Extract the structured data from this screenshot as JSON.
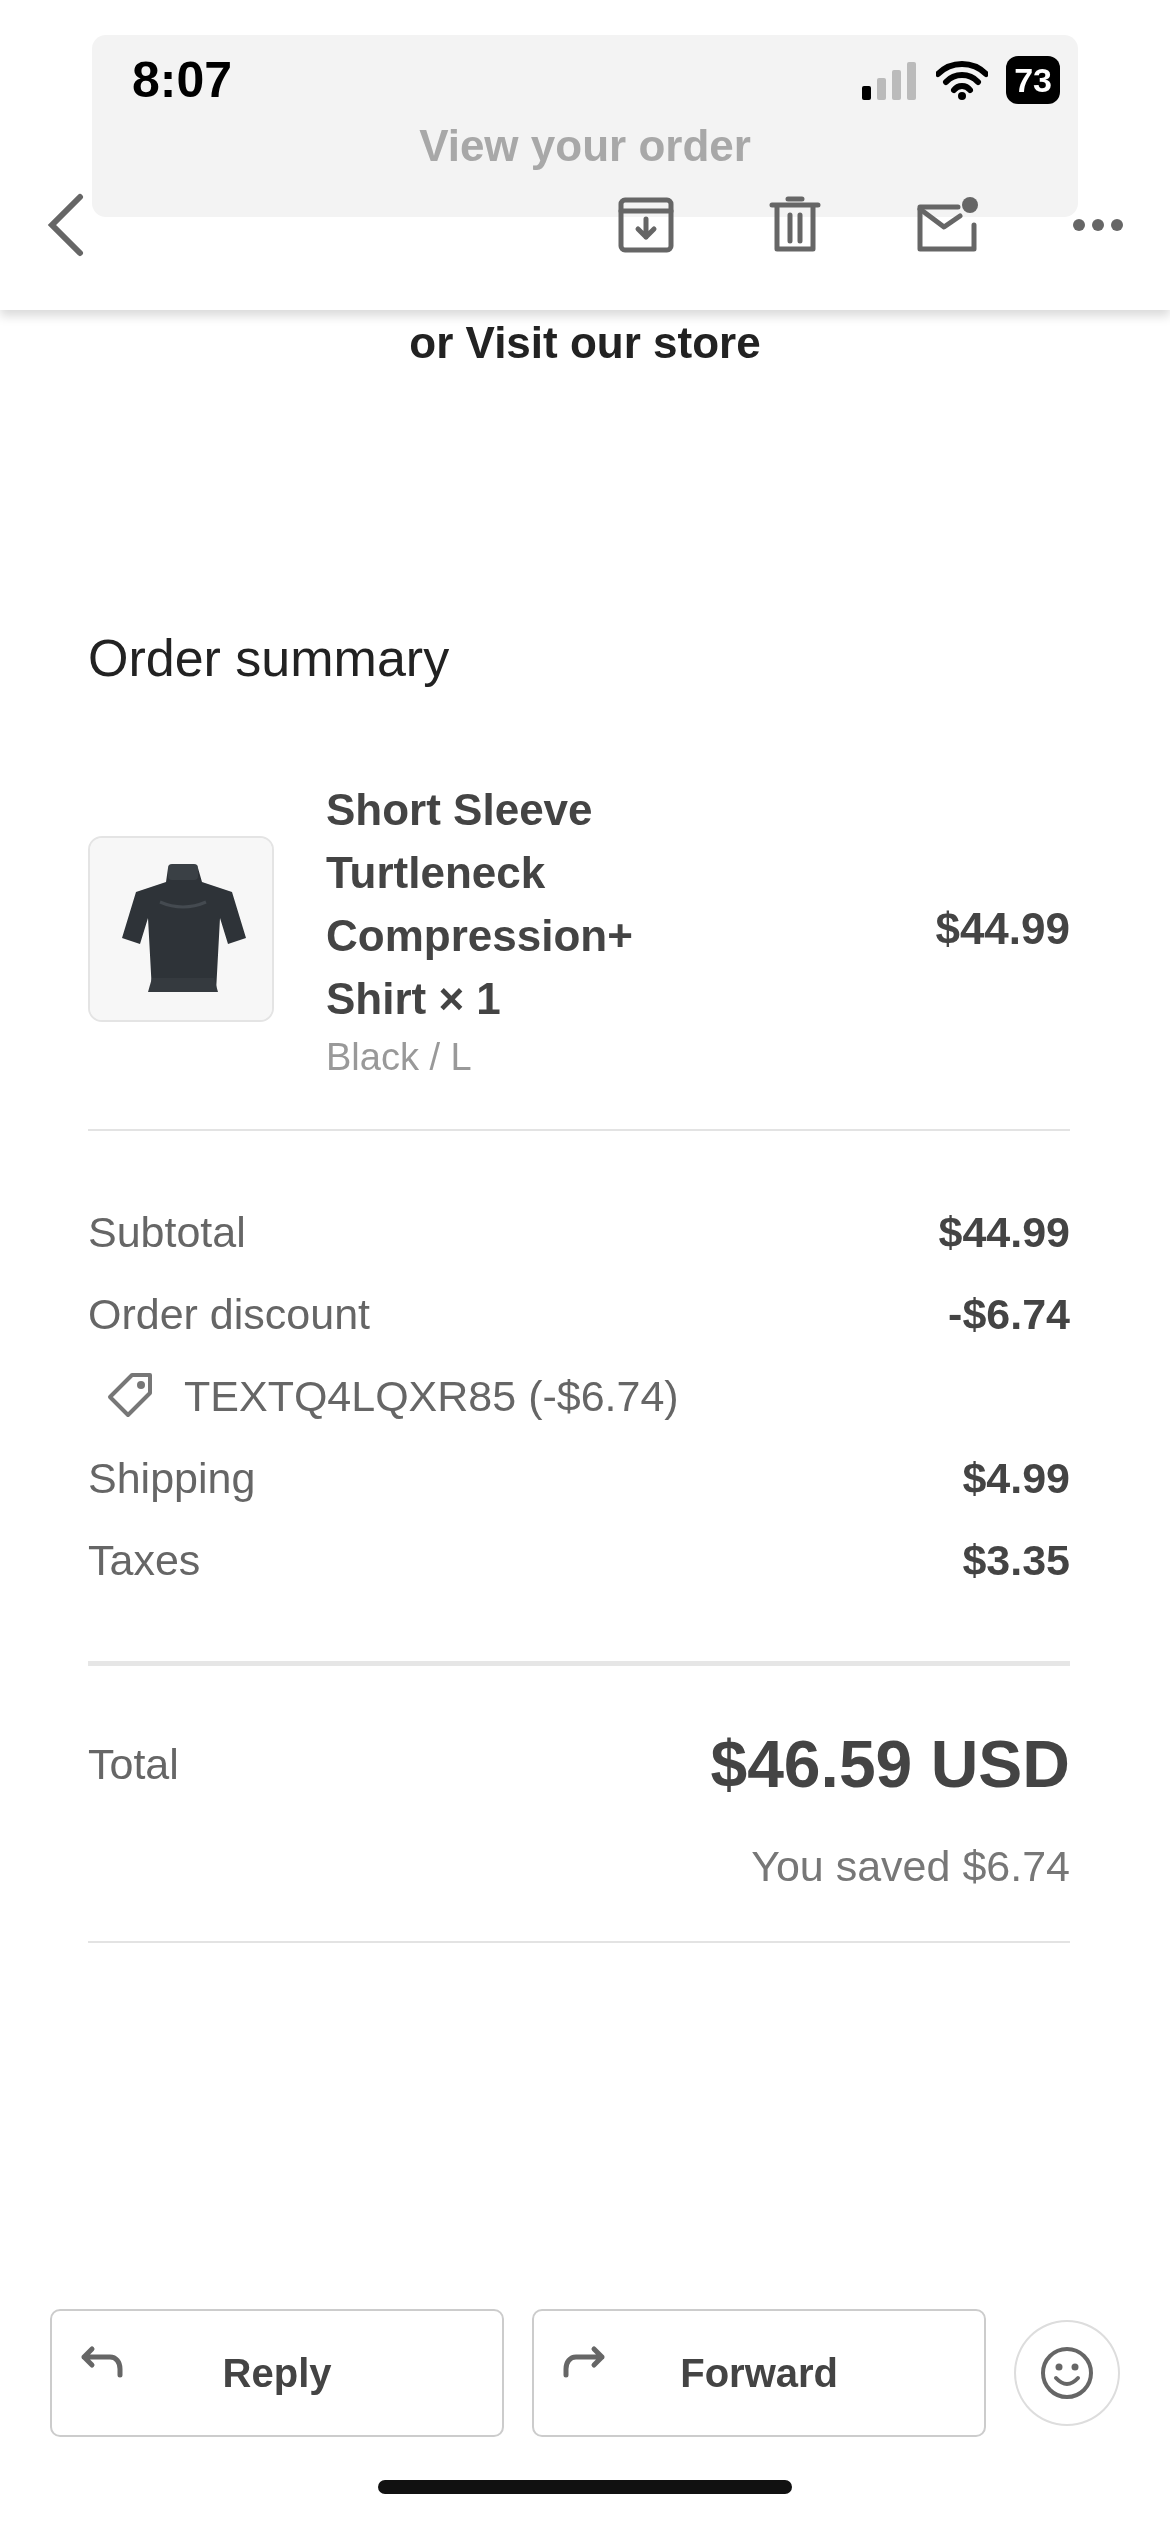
{
  "status_bar": {
    "time": "8:07",
    "battery": "73"
  },
  "banner_button": {
    "label": "View your order"
  },
  "store_link": "or Visit our store",
  "order_summary": {
    "title": "Order summary",
    "item": {
      "kind": "picture",
      "name": "Short Sleeve Turtleneck Compression+ Shirt × 1",
      "variant": "Black / L",
      "price": "$44.99"
    },
    "lines": [
      {
        "kind": "line",
        "label": "Subtotal",
        "value": "$44.99"
      },
      {
        "kind": "line",
        "label": "Order discount",
        "value": "-$6.74"
      },
      {
        "kind": "code",
        "label": "TEXTQ4LQXR85 (-$6.74)"
      },
      {
        "kind": "line",
        "label": "Shipping",
        "value": "$4.99"
      },
      {
        "kind": "line",
        "label": "Taxes",
        "value": "$3.35"
      }
    ],
    "total": {
      "label": "Total",
      "value": "$46.59 USD",
      "saved": "You saved $6.74"
    }
  },
  "reply_bar": {
    "buttons": [
      {
        "kind": "reply",
        "label": "Reply"
      },
      {
        "kind": "forward",
        "label": "Forward"
      }
    ]
  }
}
